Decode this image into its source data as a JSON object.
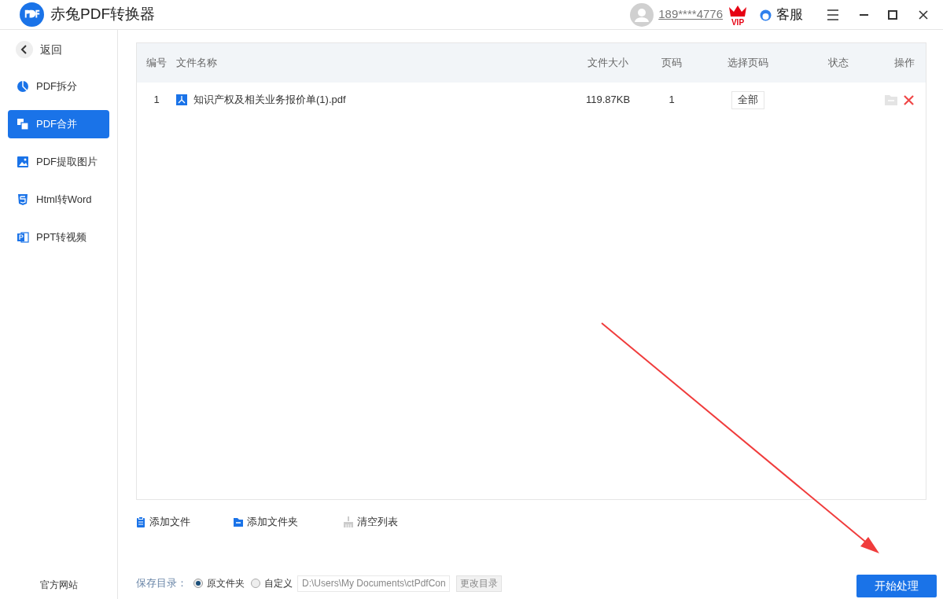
{
  "app": {
    "title": "赤兔PDF转换器"
  },
  "account": {
    "phone": "189****4776",
    "badge": "VIP"
  },
  "support": {
    "label": "客服"
  },
  "sidebar": {
    "back": "返回",
    "items": [
      {
        "kind": "split",
        "label": "PDF拆分",
        "selected": false
      },
      {
        "kind": "merge",
        "label": "PDF合并",
        "selected": true
      },
      {
        "kind": "image",
        "label": "PDF提取图片",
        "selected": false
      },
      {
        "kind": "html",
        "label": "Html转Word",
        "selected": false
      },
      {
        "kind": "ppt",
        "label": "PPT转视频",
        "selected": false
      }
    ],
    "footer": "官方网站"
  },
  "table": {
    "columns": [
      "编号",
      "文件名称",
      "文件大小",
      "页码",
      "选择页码",
      "状态",
      "操作"
    ],
    "rows": [
      {
        "index": "1",
        "file_name": "知识产权及相关业务报价单(1).pdf",
        "size": "119.87KB",
        "pages": "1",
        "page_selection": "全部"
      }
    ]
  },
  "toolbar": [
    {
      "kind": "add_file",
      "label": "添加文件"
    },
    {
      "kind": "add_folder",
      "label": "添加文件夹"
    },
    {
      "kind": "clear",
      "label": "清空列表"
    }
  ],
  "save": {
    "label": "保存目录：",
    "options": [
      {
        "label": "原文件夹",
        "selected": true
      },
      {
        "label": "自定义",
        "selected": false
      }
    ],
    "path": "D:\\Users\\My Documents\\ctPdfCon",
    "change_button": "更改目录"
  },
  "start_button": "开始处理"
}
